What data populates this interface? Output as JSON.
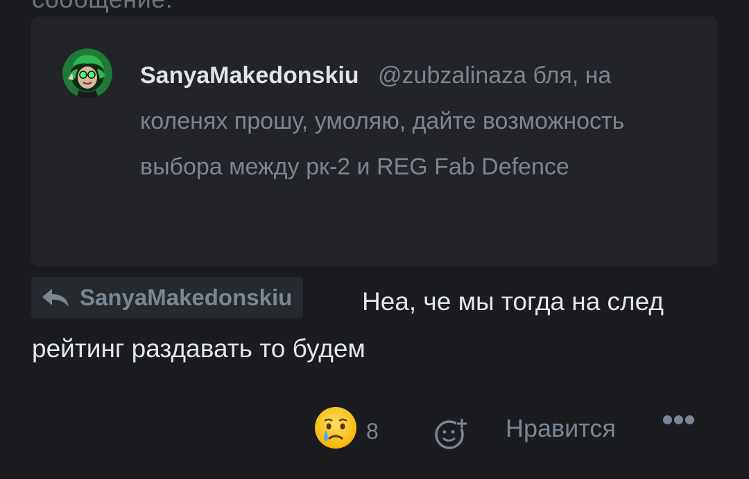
{
  "previous_message": {
    "text": "сообщение."
  },
  "quote": {
    "author": "SanyaMakedonskiu",
    "mention": "@zubzalinaza",
    "text": "бля, на коленях прошу, умоляю, дайте возможность выбора между рк-2 и REG Fab Defence"
  },
  "reply": {
    "to_label": "SanyaMakedonskiu",
    "text": "Неа, че мы тогда на след рейтинг раздавать то будем"
  },
  "actions": {
    "reaction_emoji": "crying-face",
    "reaction_count": "8",
    "like_label": "Нравится"
  },
  "colors": {
    "background": "#1b1c1f",
    "card": "#222427",
    "muted_text": "#7a8694",
    "primary_text": "#e3e6ea"
  }
}
